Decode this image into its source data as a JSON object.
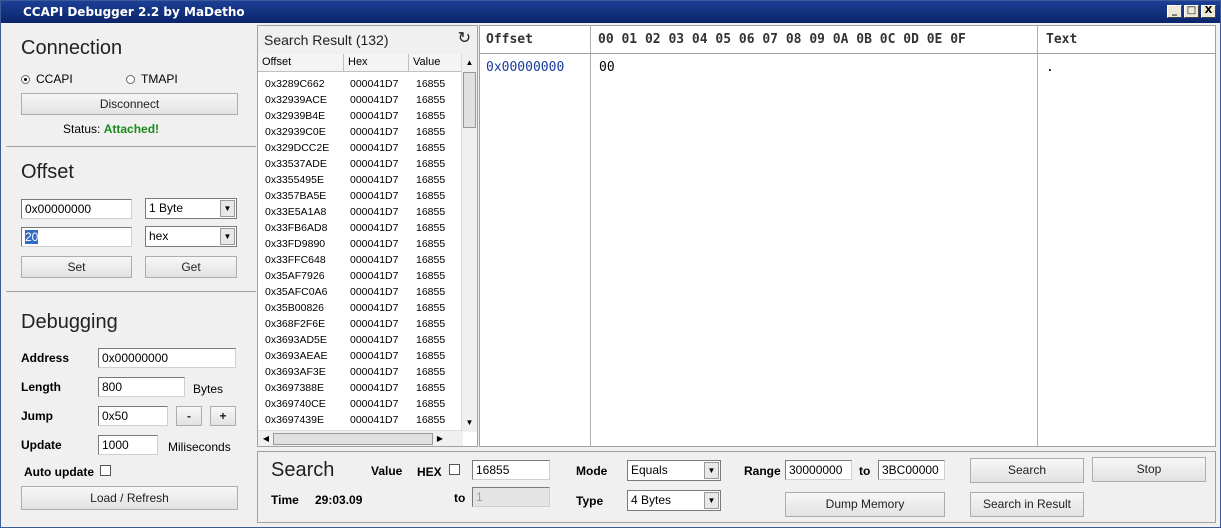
{
  "window": {
    "title": "CCAPI Debugger 2.2 by MaDetho",
    "minimize": "_",
    "maximize": "□",
    "close": "X"
  },
  "connection": {
    "title": "Connection",
    "option_ccapi": "CCAPI",
    "option_tmapi": "TMAPI",
    "selected": "CCAPI",
    "disconnect_label": "Disconnect",
    "status_label": "Status:",
    "status_value": "Attached!",
    "status_color": "#1a8a1a"
  },
  "offset": {
    "title": "Offset",
    "address_value": "0x00000000",
    "size_selected": "1 Byte",
    "value_input": "20",
    "format_selected": "hex",
    "set_label": "Set",
    "get_label": "Get"
  },
  "debugging": {
    "title": "Debugging",
    "address_label": "Address",
    "address_value": "0x00000000",
    "length_label": "Length",
    "length_value": "800",
    "length_unit": "Bytes",
    "jump_label": "Jump",
    "jump_value": "0x50",
    "jump_minus": "-",
    "jump_plus": "+",
    "update_label": "Update",
    "update_value": "1000",
    "update_unit": "Miliseconds",
    "auto_update_label": "Auto update",
    "load_refresh_label": "Load / Refresh"
  },
  "results": {
    "title": "Search Result (132)",
    "refresh_icon": "↻",
    "col_offset": "Offset",
    "col_hex": "Hex",
    "col_value": "Value",
    "rows": [
      [
        "0x3289C662",
        "000041D7",
        "16855"
      ],
      [
        "0x32939ACE",
        "000041D7",
        "16855"
      ],
      [
        "0x32939B4E",
        "000041D7",
        "16855"
      ],
      [
        "0x32939C0E",
        "000041D7",
        "16855"
      ],
      [
        "0x329DCC2E",
        "000041D7",
        "16855"
      ],
      [
        "0x33537ADE",
        "000041D7",
        "16855"
      ],
      [
        "0x3355495E",
        "000041D7",
        "16855"
      ],
      [
        "0x3357BA5E",
        "000041D7",
        "16855"
      ],
      [
        "0x33E5A1A8",
        "000041D7",
        "16855"
      ],
      [
        "0x33FB6AD8",
        "000041D7",
        "16855"
      ],
      [
        "0x33FD9890",
        "000041D7",
        "16855"
      ],
      [
        "0x33FFC648",
        "000041D7",
        "16855"
      ],
      [
        "0x35AF7926",
        "000041D7",
        "16855"
      ],
      [
        "0x35AFC0A6",
        "000041D7",
        "16855"
      ],
      [
        "0x35B00826",
        "000041D7",
        "16855"
      ],
      [
        "0x368F2F6E",
        "000041D7",
        "16855"
      ],
      [
        "0x3693AD5E",
        "000041D7",
        "16855"
      ],
      [
        "0x3693AEAE",
        "000041D7",
        "16855"
      ],
      [
        "0x3693AF3E",
        "000041D7",
        "16855"
      ],
      [
        "0x3697388E",
        "000041D7",
        "16855"
      ],
      [
        "0x369740CE",
        "000041D7",
        "16855"
      ],
      [
        "0x3697439E",
        "000041D7",
        "16855"
      ]
    ]
  },
  "hexview": {
    "col_offset": "Offset",
    "col_bytes": "00 01 02 03 04 05 06 07 08 09 0A 0B 0C 0D 0E 0F",
    "col_text": "Text",
    "row_offset": "0x00000000",
    "row_bytes": "00",
    "row_text": ".",
    "offset_color": "#1a3aa0"
  },
  "search": {
    "title": "Search",
    "value_label": "Value",
    "hex_label": "HEX",
    "value_input": "16855",
    "to_label": "to",
    "to_input": "1",
    "time_label": "Time",
    "time_value": "29:03.09",
    "mode_label": "Mode",
    "mode_selected": "Equals",
    "type_label": "Type",
    "type_selected": "4 Bytes",
    "range_label": "Range",
    "range_from": "30000000",
    "range_to_label": "to",
    "range_to": "3BC00000",
    "search_button": "Search",
    "stop_button": "Stop",
    "dump_button": "Dump Memory",
    "search_in_result_button": "Search in Result"
  }
}
